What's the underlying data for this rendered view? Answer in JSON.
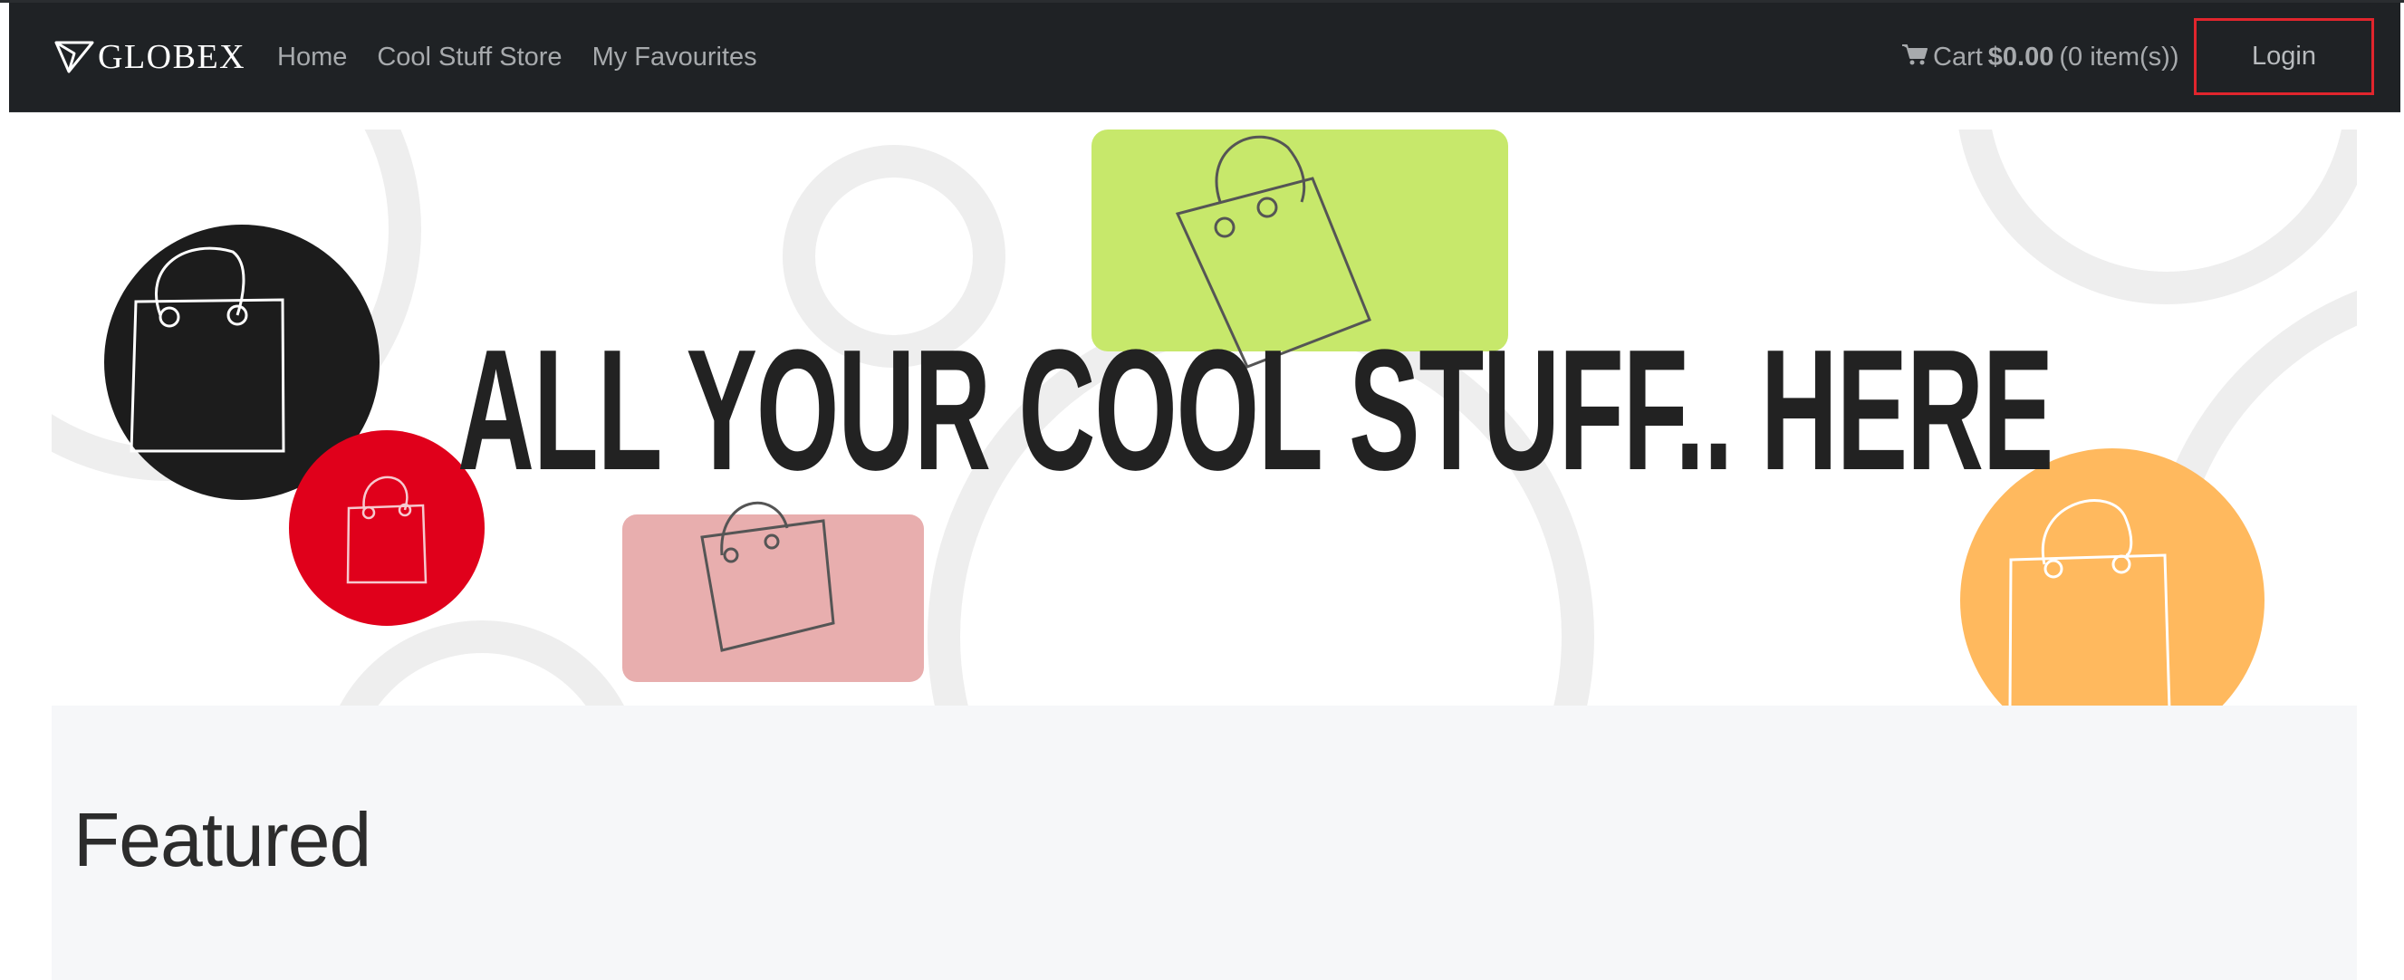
{
  "navbar": {
    "brand": "GLOBEX",
    "brand_icon": "paper-plane-icon",
    "links": [
      "Home",
      "Cool Stuff Store",
      "My Favourites"
    ],
    "cart": {
      "icon": "shopping-cart-icon",
      "label": "Cart",
      "total": "$0.00",
      "count": "(0 item(s))"
    },
    "login_label": "Login"
  },
  "hero": {
    "headline": "ALL YOUR COOL STUFF.. HERE",
    "colors": {
      "black_circle": "#1c1c1c",
      "red_circle": "#e0001b",
      "green_block": "#c7e86b",
      "pink_block": "#e8aeae",
      "orange_circle": "#ffb95e",
      "ring_gray": "#eeeeee"
    }
  },
  "featured": {
    "title": "Featured"
  },
  "accent": "#e1252d"
}
